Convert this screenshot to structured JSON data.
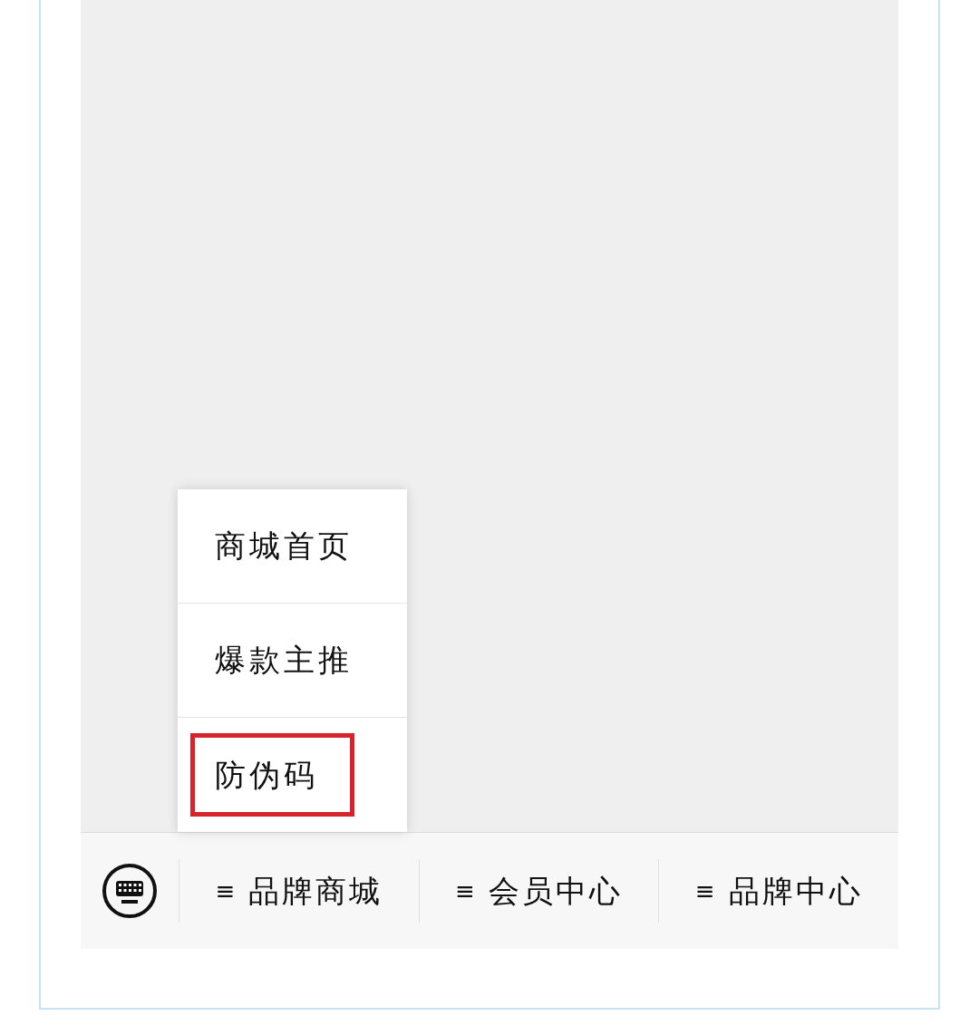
{
  "popup_menu": {
    "items": [
      {
        "label": "商城首页",
        "marked": false
      },
      {
        "label": "爆款主推",
        "marked": false
      },
      {
        "label": "防伪码",
        "marked": true
      }
    ]
  },
  "bottom_bar": {
    "tabs": [
      {
        "icon": "≡",
        "label": "品牌商城"
      },
      {
        "icon": "≡",
        "label": "会员中心"
      },
      {
        "icon": "≡",
        "label": "品牌中心"
      }
    ]
  }
}
